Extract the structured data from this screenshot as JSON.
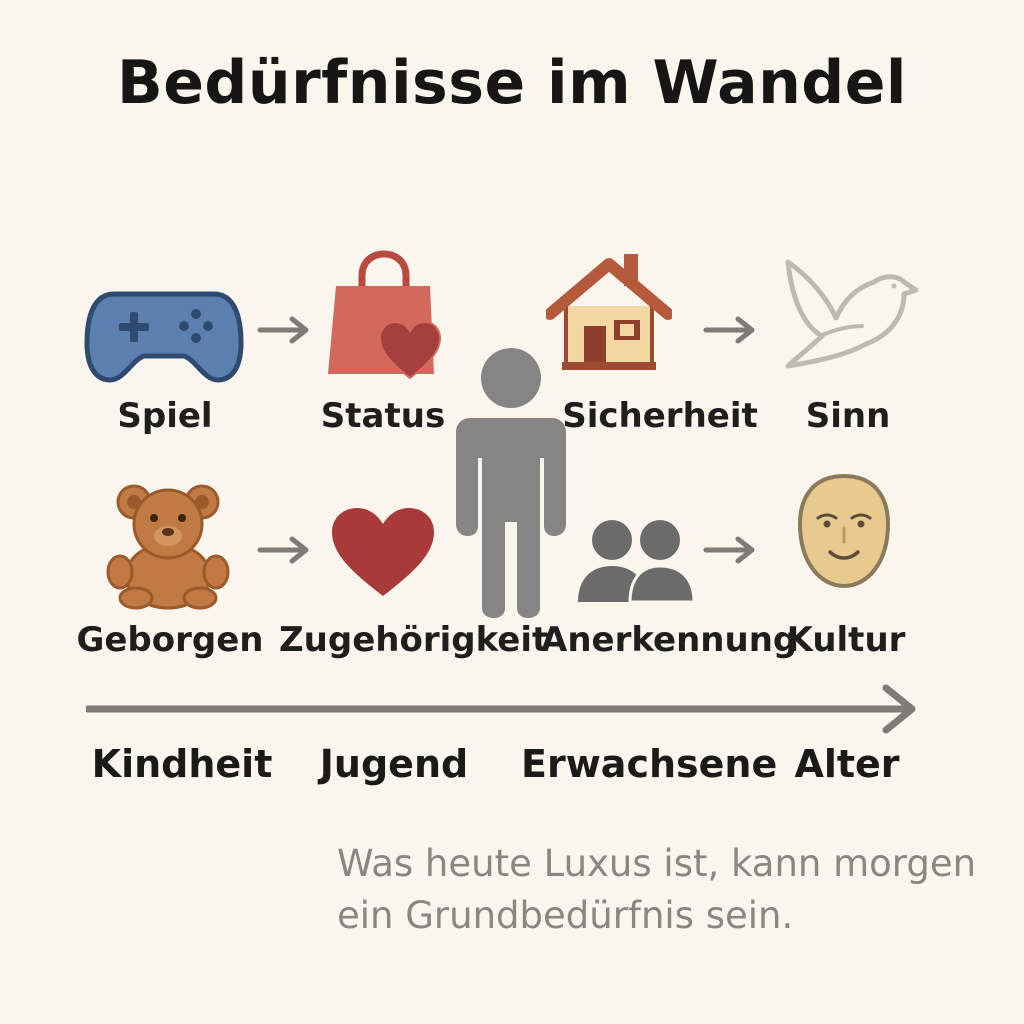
{
  "title": "Bedürfnisse im Wandel",
  "top_row": [
    {
      "label": "Spiel",
      "icon": "gamepad-icon",
      "color": "#5b7fae"
    },
    {
      "label": "Status",
      "icon": "shopping-bag-heart-icon",
      "color": "#d2695c"
    },
    {
      "label": "Sicherheit",
      "icon": "house-icon",
      "color": "#b65a3c"
    },
    {
      "label": "Sinn",
      "icon": "dove-icon",
      "color": "#bdbab3"
    }
  ],
  "bottom_row": [
    {
      "label": "Geborgen",
      "icon": "teddy-bear-icon",
      "color": "#c27a44"
    },
    {
      "label": "Zugehörigkeit",
      "icon": "heart-icon",
      "color": "#a83a38"
    },
    {
      "label": "Anerkennung",
      "icon": "people-icon",
      "color": "#6b6b6b"
    },
    {
      "label": "Kultur",
      "icon": "mask-icon",
      "color": "#e8c98e"
    }
  ],
  "center_figure": {
    "icon": "person-icon",
    "color": "#858585"
  },
  "stages": [
    "Kindheit",
    "Jugend",
    "Erwachsene",
    "Alter"
  ],
  "caption": {
    "line1": "Was heute Luxus ist, kann morgen",
    "line2": "ein Grundbedürfnis sein."
  }
}
